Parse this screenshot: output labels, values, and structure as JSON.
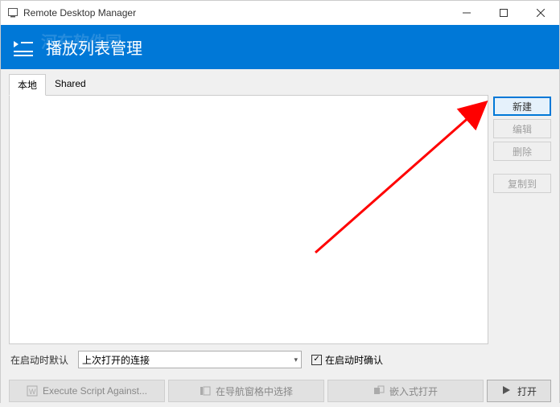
{
  "window": {
    "title": "Remote Desktop Manager"
  },
  "banner": {
    "title": "播放列表管理",
    "watermark": "河东软件园"
  },
  "tabs": {
    "local": "本地",
    "shared": "Shared"
  },
  "side": {
    "new": "新建",
    "edit": "编辑",
    "delete": "删除",
    "copyto": "复制到"
  },
  "bottom": {
    "default_label": "在启动时默认",
    "select_value": "上次打开的连接",
    "confirm_label": "在启动时确认"
  },
  "footer": {
    "script": "Execute Script Against...",
    "nav_select": "在导航窗格中选择",
    "embed_open": "嵌入式打开",
    "open": "打开"
  }
}
